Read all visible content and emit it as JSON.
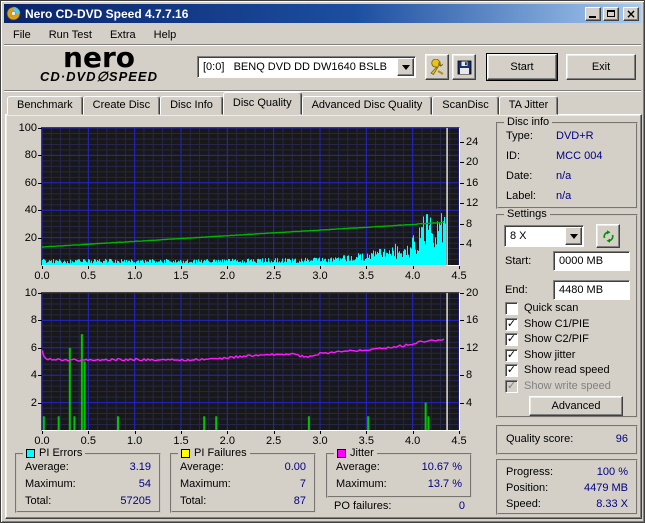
{
  "window": {
    "title": "Nero CD-DVD Speed 4.7.7.16"
  },
  "menu": {
    "items": [
      "File",
      "Run Test",
      "Extra",
      "Help"
    ]
  },
  "toolbar": {
    "logo_line1": "nero",
    "logo_line2": "CD·DVD∅SPEED",
    "drive_selector": "[0:0]   BENQ DVD DD DW1640 BSLB",
    "options_icon": "options-icon",
    "save_icon": "save-icon",
    "start_label": "Start",
    "exit_label": "Exit"
  },
  "tabs": {
    "active_index": 3,
    "items": [
      {
        "label": "Benchmark"
      },
      {
        "label": "Create Disc"
      },
      {
        "label": "Disc Info"
      },
      {
        "label": "Disc Quality"
      },
      {
        "label": "Advanced Disc Quality"
      },
      {
        "label": "ScanDisc"
      },
      {
        "label": "TA Jitter"
      }
    ]
  },
  "disc_info": {
    "title": "Disc info",
    "rows": [
      {
        "label": "Type:",
        "value": "DVD+R"
      },
      {
        "label": "ID:",
        "value": "MCC 004"
      },
      {
        "label": "Date:",
        "value": "n/a"
      },
      {
        "label": "Label:",
        "value": "n/a"
      }
    ]
  },
  "settings": {
    "title": "Settings",
    "speed_selected": "8 X",
    "start_label": "Start:",
    "start_value": "0000 MB",
    "end_label": "End:",
    "end_value": "4480 MB",
    "checkboxes": [
      {
        "label": "Quick scan",
        "checked": false,
        "enabled": true
      },
      {
        "label": "Show C1/PIE",
        "checked": true,
        "enabled": true
      },
      {
        "label": "Show C2/PIF",
        "checked": true,
        "enabled": true
      },
      {
        "label": "Show jitter",
        "checked": true,
        "enabled": true
      },
      {
        "label": "Show read speed",
        "checked": true,
        "enabled": true
      },
      {
        "label": "Show write speed",
        "checked": true,
        "enabled": false
      }
    ],
    "advanced_label": "Advanced"
  },
  "quality": {
    "label": "Quality score:",
    "value": "96"
  },
  "progress_panel": {
    "rows": [
      {
        "label": "Progress:",
        "value": "100 %"
      },
      {
        "label": "Position:",
        "value": "4479 MB"
      },
      {
        "label": "Speed:",
        "value": "8.33 X"
      }
    ]
  },
  "stats": {
    "pi_errors": {
      "title": "PI Errors",
      "swatch": "#00ffff",
      "rows": [
        {
          "label": "Average:",
          "value": "3.19"
        },
        {
          "label": "Maximum:",
          "value": "54"
        },
        {
          "label": "Total:",
          "value": "57205"
        }
      ]
    },
    "pi_failures": {
      "title": "PI Failures",
      "swatch": "#ffff00",
      "rows": [
        {
          "label": "Average:",
          "value": "0.00"
        },
        {
          "label": "Maximum:",
          "value": "7"
        },
        {
          "label": "Total:",
          "value": "87"
        }
      ]
    },
    "jitter": {
      "title": "Jitter",
      "swatch": "#ff00ff",
      "rows": [
        {
          "label": "Average:",
          "value": "10.67 %"
        },
        {
          "label": "Maximum:",
          "value": "13.7 %"
        }
      ]
    },
    "po_failures": {
      "label": "PO failures:",
      "value": "0"
    }
  },
  "chart_data": [
    {
      "id": "pi_errors_and_read_speed",
      "type": "mixed",
      "x_range": [
        0,
        4.5
      ],
      "x_minor_step": 0.1,
      "x_ticks": [
        0.0,
        0.5,
        1.0,
        1.5,
        2.0,
        2.5,
        3.0,
        3.5,
        4.0,
        4.5
      ],
      "x_tick_labels": [
        "0.0",
        "0.5",
        "1.0",
        "1.5",
        "2.0",
        "2.5",
        "3.0",
        "3.5",
        "4.0",
        "4.5"
      ],
      "left_axis": {
        "range": [
          0,
          100
        ],
        "ticks": [
          20,
          40,
          60,
          80,
          100
        ],
        "minor_step": 4
      },
      "right_axis": {
        "range": [
          0,
          26.67
        ],
        "ticks": [
          4,
          8,
          12,
          16,
          20,
          24
        ]
      },
      "data_end_x": 4.35,
      "colors": {
        "bg": "#181818",
        "grid_major": "#2222cc",
        "grid_minor": "#26264a",
        "marker": "#e0e0e0"
      },
      "series": [
        {
          "name": "pi_errors",
          "type": "histogram",
          "axis": "left",
          "color": "#00ffff",
          "envelope": [
            [
              0,
              4.5
            ],
            [
              0.3,
              4
            ],
            [
              0.7,
              4.5
            ],
            [
              1.0,
              4
            ],
            [
              1.3,
              4.5
            ],
            [
              1.6,
              4
            ],
            [
              2.0,
              4.5
            ],
            [
              2.4,
              5
            ],
            [
              2.7,
              5
            ],
            [
              3.0,
              5.5
            ],
            [
              3.1,
              6.5
            ],
            [
              3.2,
              6.5
            ],
            [
              3.3,
              7.5
            ],
            [
              3.4,
              8.5
            ],
            [
              3.5,
              9.5
            ],
            [
              3.6,
              11
            ],
            [
              3.7,
              13
            ],
            [
              3.75,
              12
            ],
            [
              3.8,
              16
            ],
            [
              3.85,
              14
            ],
            [
              3.9,
              19
            ],
            [
              3.95,
              18
            ],
            [
              4.0,
              23
            ],
            [
              4.05,
              27
            ],
            [
              4.1,
              35
            ],
            [
              4.15,
              45
            ],
            [
              4.18,
              54
            ],
            [
              4.2,
              50
            ],
            [
              4.22,
              43
            ],
            [
              4.25,
              47
            ],
            [
              4.28,
              39
            ],
            [
              4.3,
              43
            ],
            [
              4.33,
              31
            ],
            [
              4.35,
              41
            ]
          ]
        },
        {
          "name": "read_speed",
          "type": "line",
          "axis": "right",
          "color": "#00b400",
          "noise": 0.04,
          "points": [
            [
              0,
              3.5
            ],
            [
              0.5,
              4.05
            ],
            [
              1.0,
              4.6
            ],
            [
              1.5,
              5.15
            ],
            [
              2.0,
              5.7
            ],
            [
              2.5,
              6.25
            ],
            [
              3.0,
              6.8
            ],
            [
              3.5,
              7.35
            ],
            [
              4.0,
              7.9
            ],
            [
              4.35,
              8.33
            ]
          ]
        }
      ]
    },
    {
      "id": "pi_failures_and_jitter",
      "type": "mixed",
      "x_range": [
        0,
        4.5
      ],
      "x_minor_step": 0.1,
      "x_ticks": [
        0.0,
        0.5,
        1.0,
        1.5,
        2.0,
        2.5,
        3.0,
        3.5,
        4.0,
        4.5
      ],
      "x_tick_labels": [
        "0.0",
        "0.5",
        "1.0",
        "1.5",
        "2.0",
        "2.5",
        "3.0",
        "3.5",
        "4.0",
        "4.5"
      ],
      "left_axis": {
        "range": [
          0,
          10
        ],
        "ticks": [
          2,
          4,
          6,
          8,
          10
        ],
        "minor_step": 0.4
      },
      "right_axis": {
        "range": [
          0,
          20
        ],
        "ticks": [
          4,
          8,
          12,
          16,
          20
        ]
      },
      "data_end_x": 4.35,
      "colors": {
        "bg": "#181818",
        "grid_major": "#2222cc",
        "grid_minor": "#26264a",
        "marker": "#e0e0e0"
      },
      "series": [
        {
          "name": "pi_failures",
          "type": "spikes",
          "axis": "left",
          "color": "#00c800",
          "points": [
            [
              0.02,
              1
            ],
            [
              0.18,
              1
            ],
            [
              0.3,
              6
            ],
            [
              0.35,
              1
            ],
            [
              0.43,
              7
            ],
            [
              0.46,
              5
            ],
            [
              0.82,
              1
            ],
            [
              1.75,
              1
            ],
            [
              1.88,
              1
            ],
            [
              2.88,
              1
            ],
            [
              3.52,
              1
            ],
            [
              4.14,
              2
            ],
            [
              4.17,
              1
            ]
          ]
        },
        {
          "name": "jitter",
          "type": "line",
          "axis": "right",
          "color": "#ff1aff",
          "noise": 0.16,
          "points": [
            [
              0,
              11.6
            ],
            [
              0.04,
              10.3
            ],
            [
              0.5,
              10.2
            ],
            [
              1.0,
              10.3
            ],
            [
              1.5,
              10.2
            ],
            [
              1.9,
              10.4
            ],
            [
              2.2,
              10.8
            ],
            [
              2.5,
              11.0
            ],
            [
              2.7,
              11.1
            ],
            [
              2.85,
              10.6
            ],
            [
              3.0,
              11.2
            ],
            [
              3.3,
              11.5
            ],
            [
              3.6,
              11.9
            ],
            [
              3.9,
              12.3
            ],
            [
              4.1,
              12.9
            ],
            [
              4.2,
              13.0
            ],
            [
              4.3,
              13.3
            ],
            [
              4.35,
              13.2
            ]
          ]
        }
      ]
    }
  ]
}
